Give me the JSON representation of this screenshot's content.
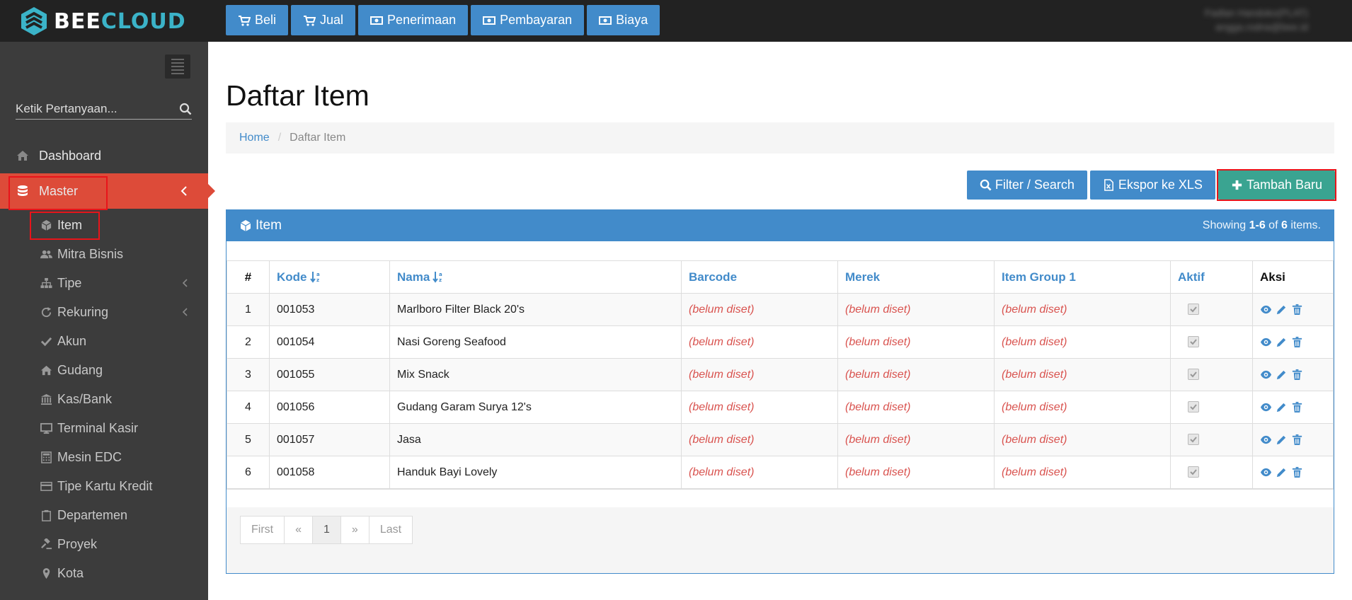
{
  "brand": {
    "name_part1": "BEE",
    "name_part2": "CLOUD"
  },
  "topnav": [
    {
      "label": "Beli",
      "icon": "cart-icon"
    },
    {
      "label": "Jual",
      "icon": "cart-icon"
    },
    {
      "label": "Penerimaan",
      "icon": "money-icon"
    },
    {
      "label": "Pembayaran",
      "icon": "money-icon"
    },
    {
      "label": "Biaya",
      "icon": "money-icon"
    }
  ],
  "user": {
    "name": "Fadlan Handoko(PLAT)",
    "email": "angga.rodna@bee.id"
  },
  "sidebar": {
    "search_placeholder": "Ketik Pertanyaan...",
    "items": [
      {
        "label": "Dashboard",
        "icon": "home-icon"
      },
      {
        "label": "Master",
        "icon": "database-icon",
        "active": true
      }
    ],
    "sub_items": [
      {
        "label": "Item",
        "icon": "cube-icon"
      },
      {
        "label": "Mitra Bisnis",
        "icon": "users-icon"
      },
      {
        "label": "Tipe",
        "icon": "sitemap-icon"
      },
      {
        "label": "Rekuring",
        "icon": "refresh-icon"
      },
      {
        "label": "Akun",
        "icon": "check-icon"
      },
      {
        "label": "Gudang",
        "icon": "home-icon"
      },
      {
        "label": "Kas/Bank",
        "icon": "bank-icon"
      },
      {
        "label": "Terminal Kasir",
        "icon": "desktop-icon"
      },
      {
        "label": "Mesin EDC",
        "icon": "calculator-icon"
      },
      {
        "label": "Tipe Kartu Kredit",
        "icon": "credit-card-icon"
      },
      {
        "label": "Departemen",
        "icon": "clipboard-icon"
      },
      {
        "label": "Proyek",
        "icon": "gavel-icon"
      },
      {
        "label": "Kota",
        "icon": "map-marker-icon"
      }
    ]
  },
  "page": {
    "title": "Daftar Item",
    "breadcrumb": {
      "home": "Home",
      "current": "Daftar Item"
    },
    "actions": {
      "filter": "Filter / Search",
      "export": "Ekspor ke XLS",
      "add": "Tambah Baru"
    }
  },
  "panel": {
    "title": "Item",
    "summary_prefix": "Showing ",
    "summary_range": "1-6",
    "summary_of": " of ",
    "summary_total": "6",
    "summary_suffix": " items."
  },
  "table": {
    "columns": [
      "#",
      "Kode",
      "Nama",
      "Barcode",
      "Merek",
      "Item Group 1",
      "Aktif",
      "Aksi"
    ],
    "rows": [
      {
        "no": "1",
        "kode": "001053",
        "nama": "Marlboro Filter Black 20's",
        "barcode": "(belum diset)",
        "merek": "(belum diset)",
        "group": "(belum diset)",
        "aktif": true
      },
      {
        "no": "2",
        "kode": "001054",
        "nama": "Nasi Goreng Seafood",
        "barcode": "(belum diset)",
        "merek": "(belum diset)",
        "group": "(belum diset)",
        "aktif": true
      },
      {
        "no": "3",
        "kode": "001055",
        "nama": "Mix Snack",
        "barcode": "(belum diset)",
        "merek": "(belum diset)",
        "group": "(belum diset)",
        "aktif": true
      },
      {
        "no": "4",
        "kode": "001056",
        "nama": "Gudang Garam Surya 12's",
        "barcode": "(belum diset)",
        "merek": "(belum diset)",
        "group": "(belum diset)",
        "aktif": true
      },
      {
        "no": "5",
        "kode": "001057",
        "nama": "Jasa",
        "barcode": "(belum diset)",
        "merek": "(belum diset)",
        "group": "(belum diset)",
        "aktif": true
      },
      {
        "no": "6",
        "kode": "001058",
        "nama": "Handuk Bayi Lovely",
        "barcode": "(belum diset)",
        "merek": "(belum diset)",
        "group": "(belum diset)",
        "aktif": true
      }
    ]
  },
  "pager": {
    "first": "First",
    "prev": "«",
    "current": "1",
    "next": "»",
    "last": "Last"
  },
  "colors": {
    "topbar": "#222222",
    "sidebar": "#3c3c3c",
    "accent": "#428bca",
    "active": "#dd4b39",
    "success": "#3aa491",
    "unset": "#d9534f"
  }
}
